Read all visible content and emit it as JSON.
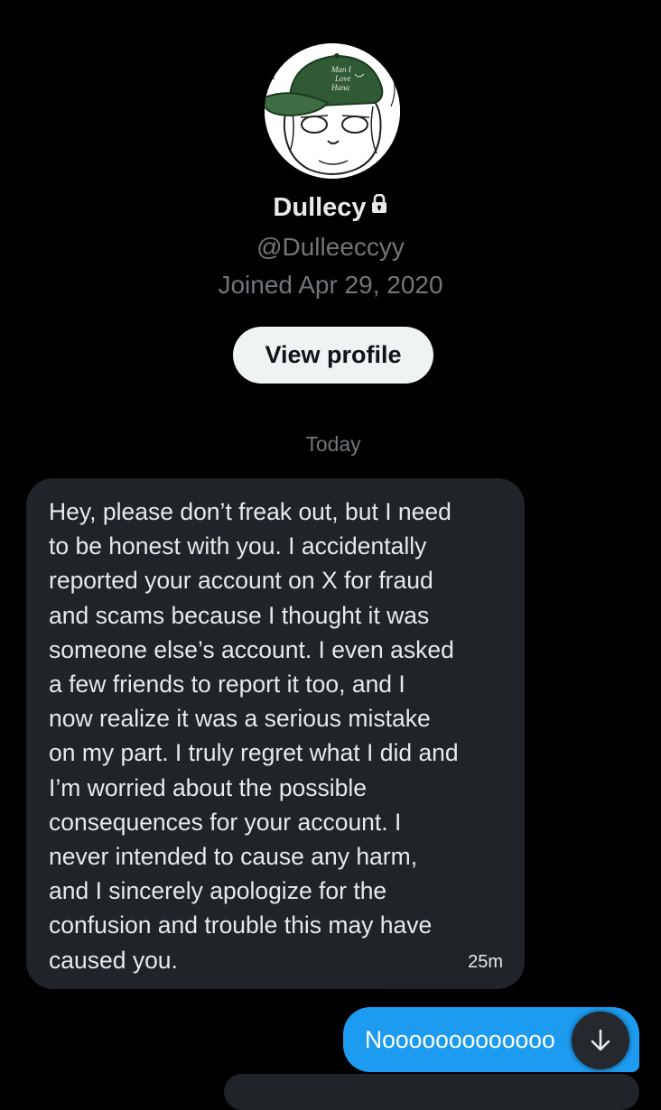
{
  "profile": {
    "display_name": "Dullecy",
    "lock_icon": "lock-icon",
    "handle": "@Dulleeccyy",
    "joined": "Joined Apr 29, 2020",
    "view_profile_label": "View profile",
    "avatar_hat_text": "Man I Love Hana"
  },
  "conversation": {
    "date_separator": "Today",
    "messages": [
      {
        "direction": "incoming",
        "text": "Hey, please don’t freak out, but I need\nto be honest with you. I accidentally\nreported your account on X for fraud\nand scams because I thought it was\nsomeone else’s account. I even asked\na few friends to report it too, and I\nnow realize it was a serious mistake\non my part. I truly regret what I did and\nI’m worried about the possible\nconsequences for your account. I\nnever intended to cause any harm,\nand I sincerely apologize for the\nconfusion and trouble this may have\ncaused you.",
        "time": "25m"
      },
      {
        "direction": "outgoing",
        "text": "Nooooooooooooo"
      }
    ],
    "scroll_down_icon": "arrow-down-icon"
  },
  "colors": {
    "background": "#000000",
    "incoming_bubble": "#202327",
    "outgoing_bubble": "#1d9bf0",
    "secondary_text": "#71767b",
    "primary_text": "#e7e9ea",
    "button_bg": "#eff3f4"
  }
}
